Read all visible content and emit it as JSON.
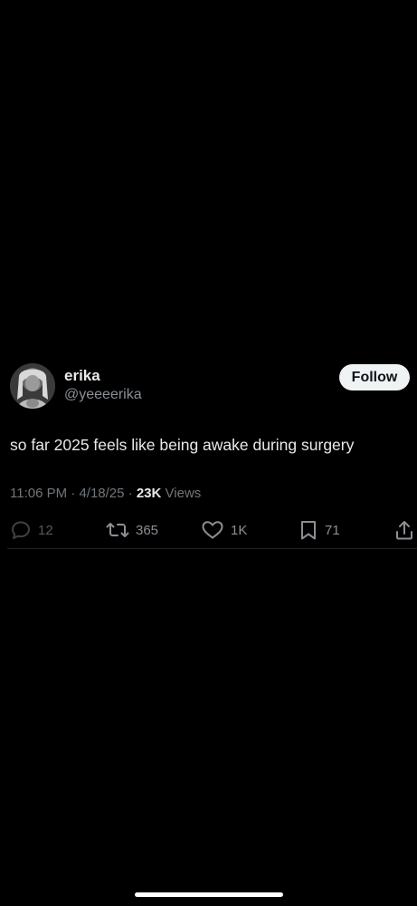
{
  "tweet": {
    "author": {
      "name": "erika",
      "handle": "@yeeeerika",
      "avatar_icon": "profile-photo"
    },
    "follow_label": "Follow",
    "text": "so far 2025 feels like being awake during surgery",
    "time": "11:06 PM",
    "date": "4/18/25",
    "separator": "·",
    "views_count": "23K",
    "views_label": "Views",
    "actions": {
      "reply": {
        "icon": "reply-icon",
        "count": "12"
      },
      "retweet": {
        "icon": "retweet-icon",
        "count": "365"
      },
      "like": {
        "icon": "heart-icon",
        "count": "1K"
      },
      "bookmark": {
        "icon": "bookmark-icon",
        "count": "71"
      },
      "share": {
        "icon": "share-icon"
      }
    }
  },
  "colors": {
    "background": "#000000",
    "primary_text": "#e7e9ea",
    "secondary_text": "#71767b",
    "follow_button_bg": "#eff3f4",
    "follow_button_text": "#0f1419"
  }
}
